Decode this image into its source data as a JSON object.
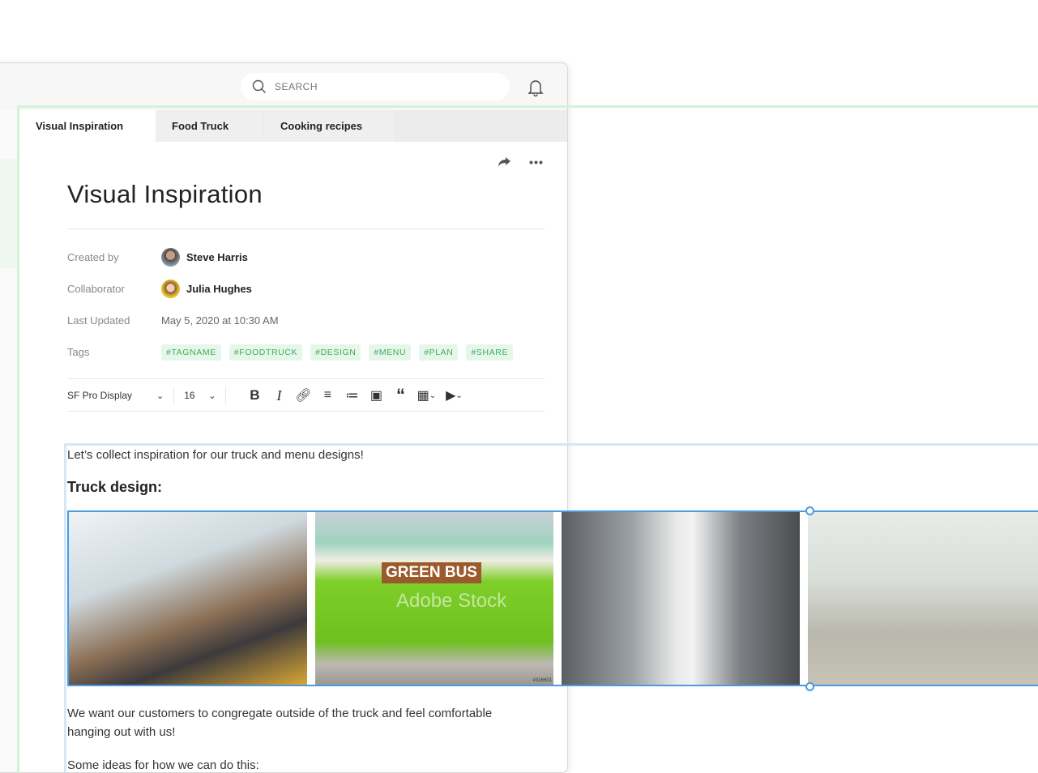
{
  "header": {
    "search_placeholder": "SEARCH",
    "icons": [
      "search-icon",
      "bell-icon"
    ]
  },
  "tabs": [
    {
      "label": "Visual Inspiration",
      "active": true
    },
    {
      "label": "Food Truck"
    },
    {
      "label": "Cooking recipes"
    }
  ],
  "doc": {
    "title": "Visual Inspiration",
    "meta": {
      "created_by_label": "Created by",
      "created_by": "Steve Harris",
      "collaborator_label": "Collaborator",
      "collaborator": "Julia Hughes",
      "updated_label": "Last Updated",
      "updated": "May 5, 2020 at 10:30 AM",
      "tags_label": "Tags",
      "tags": [
        "#TAGNAME",
        "#FOODTRUCK",
        "#DESIGN",
        "#MENU",
        "#PLAN",
        "#SHARE"
      ]
    },
    "toolbar": {
      "font": "SF Pro Display",
      "size": "16"
    },
    "body": {
      "intro": "Let’s collect inspiration for our truck and menu designs!",
      "heading": "Truck design:",
      "images": [
        {
          "name": "friends-at-food-truck"
        },
        {
          "name": "green-bus-coffee-van",
          "sign": "GREEN BUS",
          "watermark": "Adobe Stock",
          "id": "#316601"
        },
        {
          "name": "smiling-chef"
        },
        {
          "name": "couple-setting-up-truck"
        }
      ],
      "para": "We want our customers to congregate outside of the truck and feel comfortable hanging out with us!",
      "para2": "Some ideas for how we can do this:"
    }
  },
  "colors": {
    "tag_bg": "#e6f6ea",
    "tag_text": "#3fae5c",
    "selection_blue": "#4a9be0",
    "outline_green": "#d4f2d9"
  }
}
